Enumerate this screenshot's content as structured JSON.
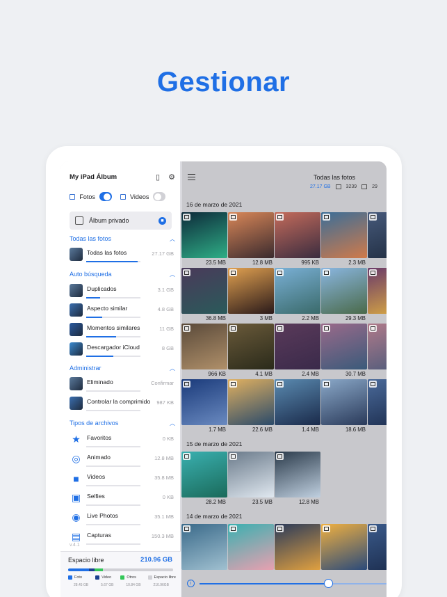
{
  "headline": "Gestionar",
  "sidebar": {
    "title": "My iPad Álbum",
    "fotos_label": "Fotos",
    "videos_label": "Videos",
    "private_album": "Álbum privado",
    "sections": {
      "all": "Todas las fotos",
      "auto": "Auto búsqueda",
      "admin": "Administrar",
      "types": "Tipos de archivos"
    },
    "all_rows": [
      {
        "name": "Todas las fotos",
        "value": "27.17 GB",
        "fill": 0.95
      }
    ],
    "auto_rows": [
      {
        "name": "Duplicados",
        "value": "3.1 GB",
        "fill": 0.25
      },
      {
        "name": "Aspecto similar",
        "value": "4.8 GB",
        "fill": 0.3
      },
      {
        "name": "Momentos similares",
        "value": "11 GB",
        "fill": 0.55
      },
      {
        "name": "Descargador iCloud",
        "value": "8 GB",
        "fill": 0.5
      }
    ],
    "admin_rows": [
      {
        "name": "Eliminado",
        "value": "Confirmar"
      },
      {
        "name": "Controlar la comprimido",
        "value": "987 KB"
      }
    ],
    "type_rows": [
      {
        "name": "Favoritos",
        "value": "0 KB",
        "icon": "star-icon"
      },
      {
        "name": "Animado",
        "value": "12.8 MB",
        "icon": "gif-icon"
      },
      {
        "name": "Videos",
        "value": "35.8 MB",
        "icon": "video-icon"
      },
      {
        "name": "Selfies",
        "value": "0 KB",
        "icon": "selfie-icon"
      },
      {
        "name": "Live Photos",
        "value": "35.1 MB",
        "icon": "live-photo-icon"
      },
      {
        "name": "Capturas",
        "value": "150.3 MB",
        "icon": "screenshot-icon"
      }
    ],
    "version": "v.4.1",
    "storage": {
      "title": "Espacio libre",
      "value": "210.96 GB",
      "legend": [
        {
          "label": "Foto",
          "size": "28.45 GB",
          "color": "#1f6fe5",
          "share": 0.2
        },
        {
          "label": "Video",
          "size": "5.67 GB",
          "color": "#1a3f8f",
          "share": 0.05
        },
        {
          "label": "Otros",
          "size": "10.84 GB",
          "color": "#34c759",
          "share": 0.08
        },
        {
          "label": "Espacio libre",
          "size": "210.96GB",
          "color": "#d1d1d6",
          "share": 0.67
        }
      ]
    }
  },
  "main": {
    "title": "Todas las fotos",
    "stats": {
      "size": "27.17 GB",
      "photos": "3239",
      "videos": "29"
    },
    "groups": [
      {
        "date": "16 de marzo de 2021",
        "rows": [
          [
            {
              "size": "23.5 MB",
              "c1": "#0d2a3a",
              "c2": "#2fae86"
            },
            {
              "size": "12.8 MB",
              "c1": "#d98758",
              "c2": "#3a2a2e"
            },
            {
              "size": "995 KB",
              "c1": "#c46b5b",
              "c2": "#3a2c3f"
            },
            {
              "size": "2.3 MB",
              "c1": "#3b6e98",
              "c2": "#d07a4a"
            },
            {
              "size": "",
              "c1": "#46597a",
              "c2": "#1e2b3e"
            }
          ],
          [
            {
              "size": "36.8 MB",
              "c1": "#4a3a5a",
              "c2": "#2a5a5a"
            },
            {
              "size": "3 MB",
              "c1": "#e0a050",
              "c2": "#2a1a1a"
            },
            {
              "size": "2.2 MB",
              "c1": "#7ab0d6",
              "c2": "#3a6a6a"
            },
            {
              "size": "29.3 MB",
              "c1": "#8ab6e0",
              "c2": "#4a6a4a"
            },
            {
              "size": "",
              "c1": "#6a3a6a",
              "c2": "#e0b040"
            }
          ],
          [
            {
              "size": "966 KB",
              "c1": "#5a4a3a",
              "c2": "#b0906a"
            },
            {
              "size": "4.1 MB",
              "c1": "#6a5a3a",
              "c2": "#2a2a1a"
            },
            {
              "size": "2.4 MB",
              "c1": "#5a3a5a",
              "c2": "#3a2a4a"
            },
            {
              "size": "30.7 MB",
              "c1": "#9a6a8a",
              "c2": "#3a5a7a"
            },
            {
              "size": "",
              "c1": "#b07a8a",
              "c2": "#4a5a7a"
            }
          ],
          [
            {
              "size": "1.7 MB",
              "c1": "#1a3a7a",
              "c2": "#6a8ac0"
            },
            {
              "size": "22.6 MB",
              "c1": "#e0b060",
              "c2": "#2a4a6a"
            },
            {
              "size": "1.4 MB",
              "c1": "#5a8ab0",
              "c2": "#1a2a4a"
            },
            {
              "size": "18.6 MB",
              "c1": "#8aa8c8",
              "c2": "#2a3a5a"
            },
            {
              "size": "",
              "c1": "#4a6a9a",
              "c2": "#1a2a4a"
            }
          ]
        ]
      },
      {
        "date": "15 de marzo de 2021",
        "rows": [
          [
            {
              "size": "28.2 MB",
              "c1": "#3ab0b0",
              "c2": "#1a6a5a"
            },
            {
              "size": "23.5 MB",
              "c1": "#6a7a8a",
              "c2": "#e0e8f0"
            },
            {
              "size": "12.8 MB",
              "c1": "#2a3a4a",
              "c2": "#c0d0e0"
            }
          ]
        ]
      },
      {
        "date": "14 de marzo de 2021",
        "rows": [
          [
            {
              "size": "",
              "c1": "#3a6a8a",
              "c2": "#a0c0d0"
            },
            {
              "size": "",
              "c1": "#3ab0b0",
              "c2": "#e8a0b0"
            },
            {
              "size": "",
              "c1": "#2a3a5a",
              "c2": "#e0a040"
            },
            {
              "size": "",
              "c1": "#f0b040",
              "c2": "#2a4a7a"
            },
            {
              "size": "",
              "c1": "#3a5a8a",
              "c2": "#1a2a4a"
            }
          ]
        ]
      }
    ],
    "zoom_slider": 0.69
  }
}
